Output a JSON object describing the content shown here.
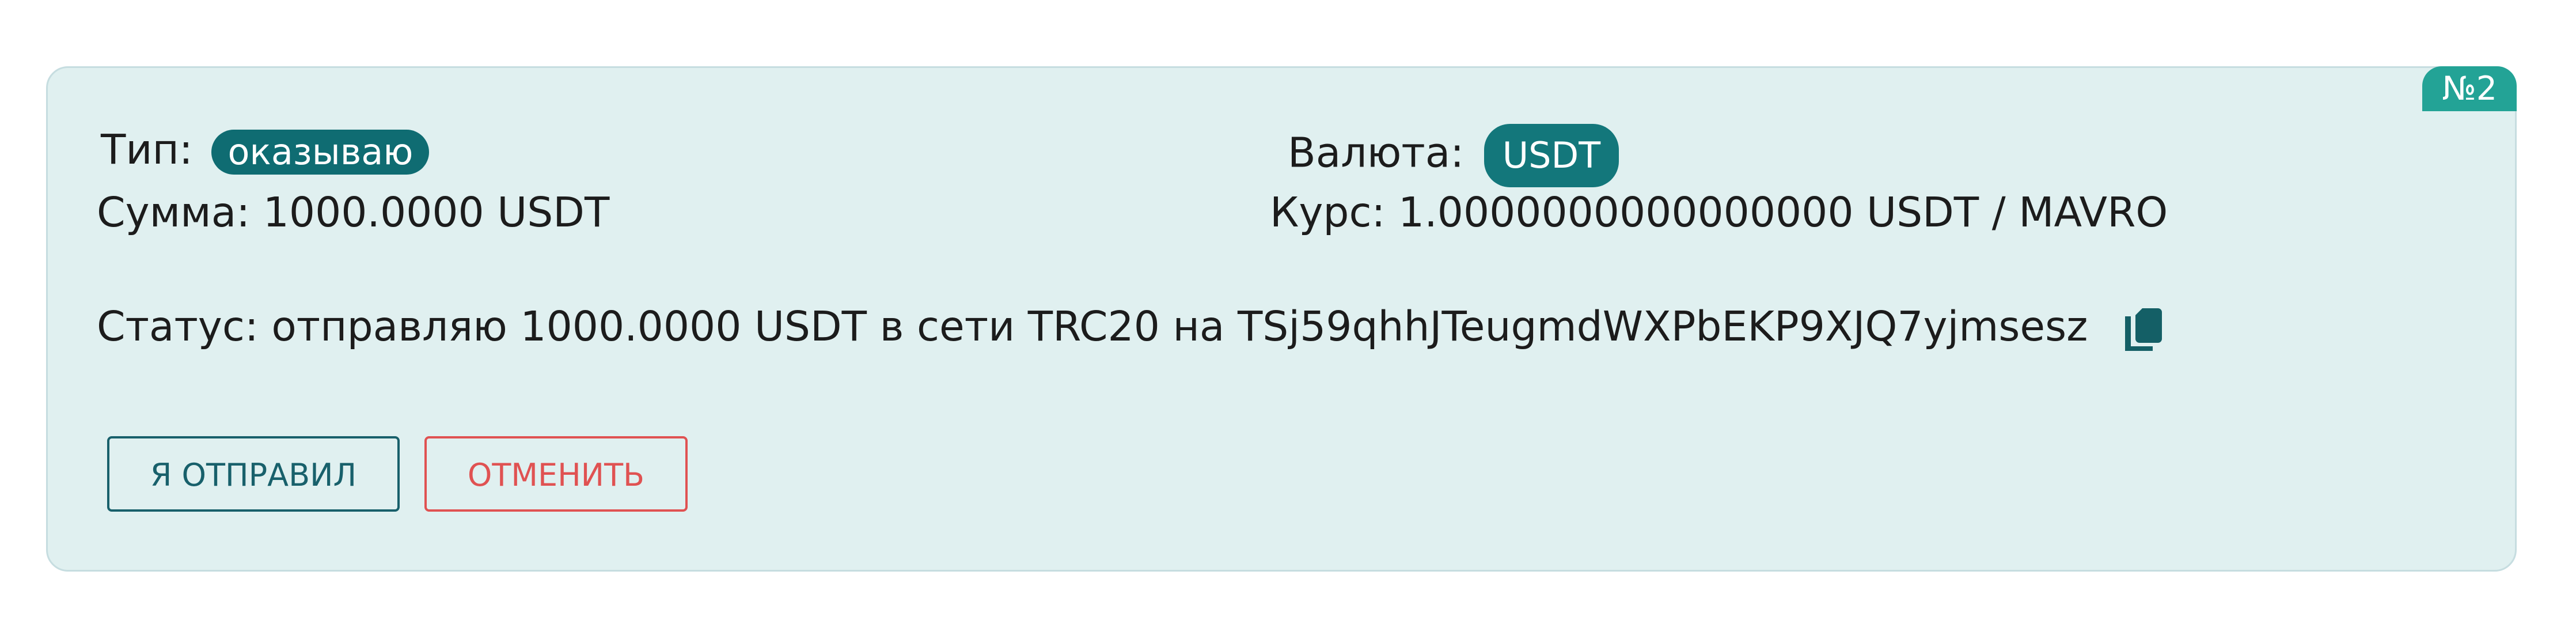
{
  "order": {
    "number": "№2",
    "type_label": "Тип:",
    "type_value": "оказываю",
    "currency_label": "Валюта:",
    "currency_value": "USDT",
    "amount_label": "Сумма:",
    "amount_value": "1000.0000 USDT",
    "rate_label": "Курс:",
    "rate_value": "1.0000000000000000 USDT / MAVRO",
    "status_label": "Статус:",
    "status_value": "отправляю 1000.0000 USDT в сети TRC20 на TSj59qhhJTeugmdWXPbEKP9XJQ7yjmsesz"
  },
  "icons": {
    "copy": "copy-icon"
  },
  "actions": {
    "sent_label": "Я ОТПРАВИЛ",
    "cancel_label": "ОТМЕНИТЬ"
  },
  "colors": {
    "card_bg": "#e0f0f0",
    "card_border": "#c6dde0",
    "badge_bg": "#23a396",
    "type_pill_bg": "#0f6c72",
    "currency_pill_bg": "#13777b",
    "primary": "#18606b",
    "danger": "#e05252"
  }
}
